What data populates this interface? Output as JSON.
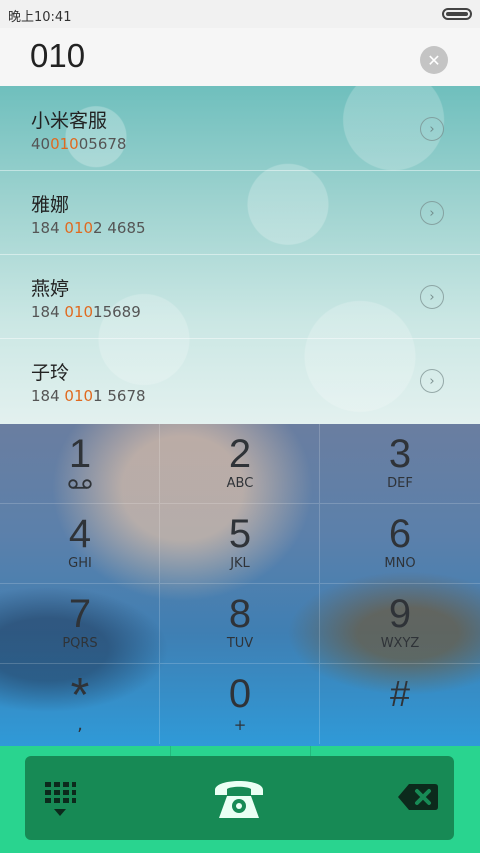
{
  "status_bar": {
    "time": "晚上10:41",
    "battery_icon": "battery-icon"
  },
  "search": {
    "value": "010",
    "clear_icon": "clear-icon"
  },
  "contacts": [
    {
      "name": "小米客服",
      "number_pre": "40",
      "number_match": "010",
      "number_post": "05678"
    },
    {
      "name": "雅娜",
      "number_pre": "184 ",
      "number_match": "010",
      "number_post": "2 4685"
    },
    {
      "name": "燕婷",
      "number_pre": "184 ",
      "number_match": "010",
      "number_post": "15689"
    },
    {
      "name": "子玲",
      "number_pre": "184 ",
      "number_match": "010",
      "number_post": "1 5678"
    }
  ],
  "keypad": {
    "keys": [
      {
        "digit": "1",
        "letters": ""
      },
      {
        "digit": "2",
        "letters": "ABC"
      },
      {
        "digit": "3",
        "letters": "DEF"
      },
      {
        "digit": "4",
        "letters": "GHI"
      },
      {
        "digit": "5",
        "letters": "JKL"
      },
      {
        "digit": "6",
        "letters": "MNO"
      },
      {
        "digit": "7",
        "letters": "PQRS"
      },
      {
        "digit": "8",
        "letters": "TUV"
      },
      {
        "digit": "9",
        "letters": "WXYZ"
      },
      {
        "digit": "*",
        "letters": ","
      },
      {
        "digit": "0",
        "letters": "+"
      },
      {
        "digit": "#",
        "letters": ""
      }
    ]
  },
  "actions": {
    "dialpad_icon": "dialpad-icon",
    "call_icon": "phone-icon",
    "backspace_icon": "backspace-icon"
  },
  "colors": {
    "match_highlight": "#e06a20",
    "action_bar": "#29d48f",
    "action_panel": "#178a55"
  }
}
